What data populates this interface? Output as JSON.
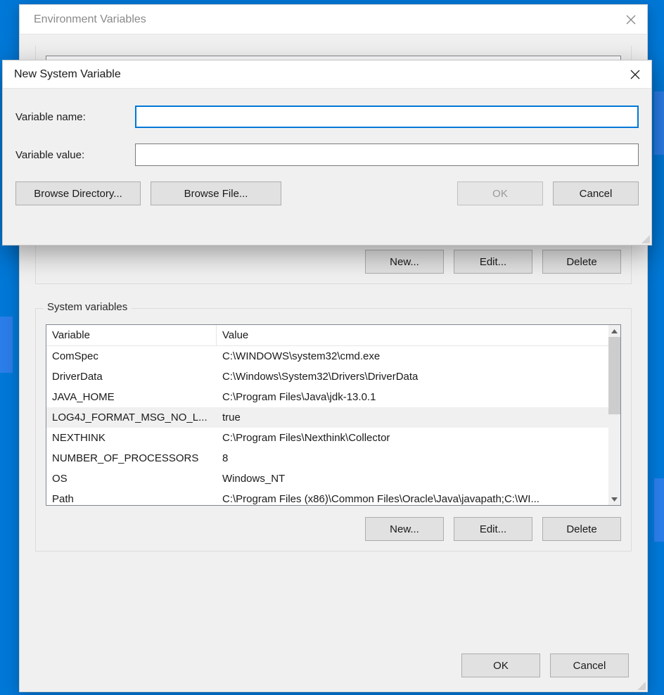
{
  "env_window": {
    "title": "Environment Variables",
    "upper_buttons": {
      "new": "New...",
      "edit": "Edit...",
      "delete": "Delete"
    },
    "system_group_label": "System variables",
    "columns": {
      "variable": "Variable",
      "value": "Value"
    },
    "system_rows": [
      {
        "name": "ComSpec",
        "value": "C:\\WINDOWS\\system32\\cmd.exe"
      },
      {
        "name": "DriverData",
        "value": "C:\\Windows\\System32\\Drivers\\DriverData"
      },
      {
        "name": "JAVA_HOME",
        "value": "C:\\Program Files\\Java\\jdk-13.0.1"
      },
      {
        "name": "LOG4J_FORMAT_MSG_NO_L...",
        "value": "true",
        "selected": true
      },
      {
        "name": "NEXTHINK",
        "value": "C:\\Program Files\\Nexthink\\Collector"
      },
      {
        "name": "NUMBER_OF_PROCESSORS",
        "value": "8"
      },
      {
        "name": "OS",
        "value": "Windows_NT"
      },
      {
        "name": "Path",
        "value": "C:\\Program Files (x86)\\Common Files\\Oracle\\Java\\javapath;C:\\WI..."
      }
    ],
    "lower_buttons": {
      "new": "New...",
      "edit": "Edit...",
      "delete": "Delete"
    },
    "main_buttons": {
      "ok": "OK",
      "cancel": "Cancel"
    }
  },
  "nsv_window": {
    "title": "New System Variable",
    "name_label": "Variable name:",
    "value_label": "Variable value:",
    "name_value": "",
    "value_value": "",
    "browse_dir": "Browse Directory...",
    "browse_file": "Browse File...",
    "ok": "OK",
    "cancel": "Cancel"
  }
}
